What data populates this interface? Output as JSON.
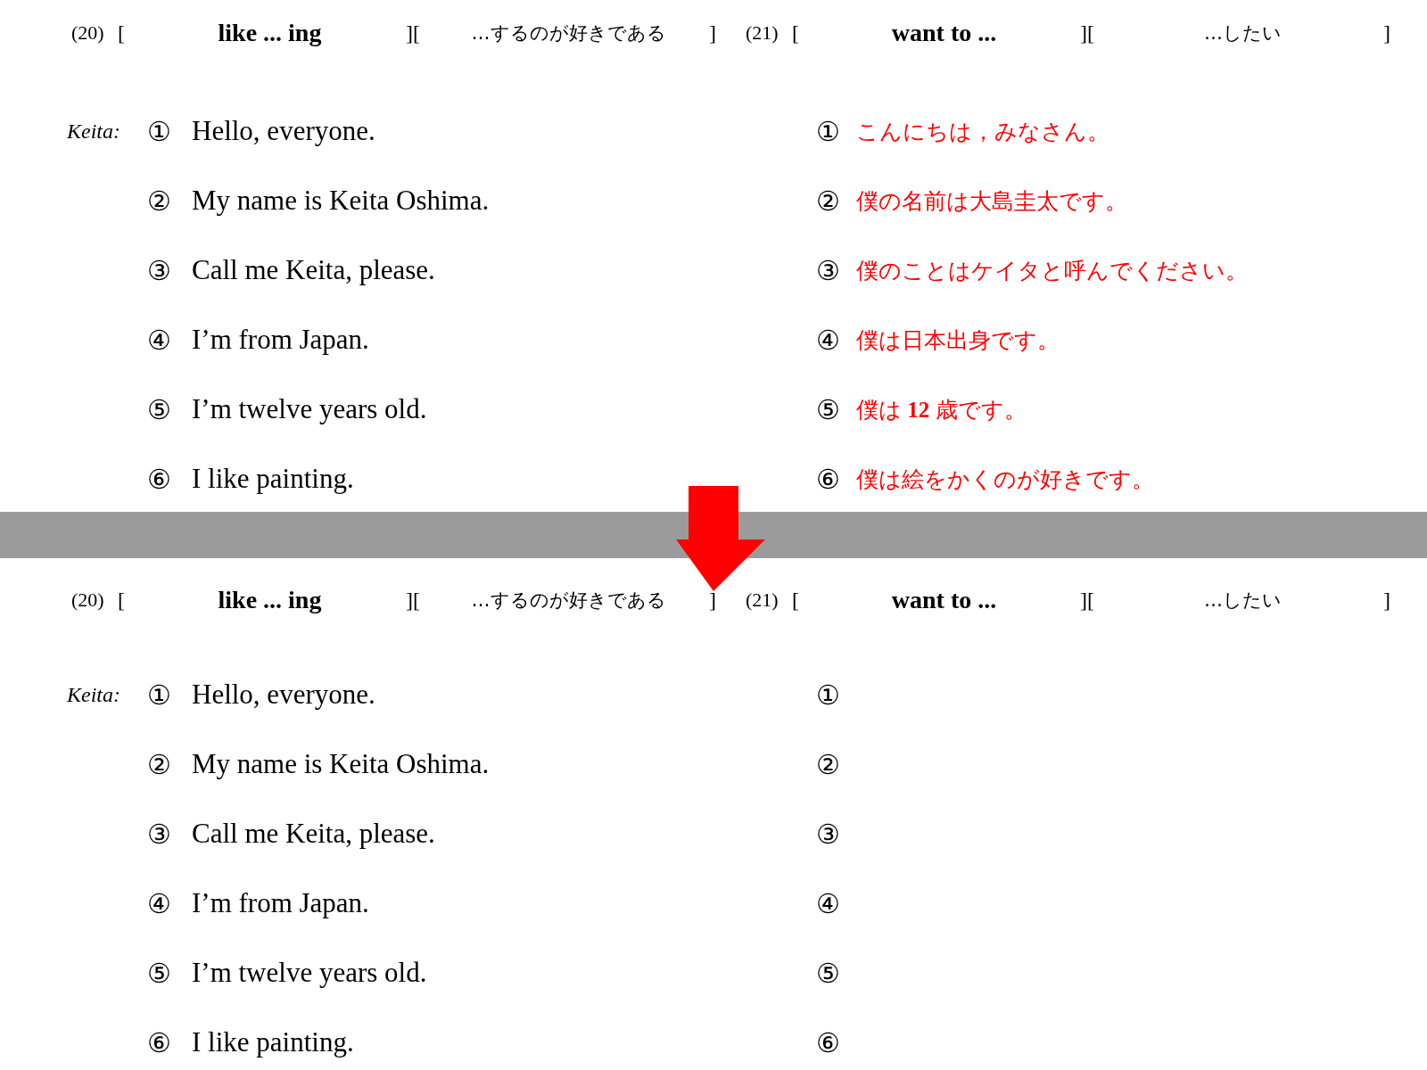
{
  "panels": [
    {
      "vocab": [
        {
          "number": "(20)",
          "open": "[",
          "english": "like ... ing",
          "middle": "][",
          "japanese": "…するのが好きである",
          "close": "]"
        },
        {
          "number": "(21)",
          "open": "[",
          "english": "want to ...",
          "middle": "][",
          "japanese": "…したい",
          "close": "]"
        }
      ],
      "speaker": "Keita:",
      "lines": [
        {
          "marker": "①",
          "english": "Hello, everyone.",
          "answer_marker": "①",
          "translation": "こんにちは，みなさん。"
        },
        {
          "marker": "②",
          "english": "My name is Keita Oshima.",
          "answer_marker": "②",
          "translation": "僕の名前は大島圭太です。"
        },
        {
          "marker": "③",
          "english": "Call me Keita, please.",
          "answer_marker": "③",
          "translation": "僕のことはケイタと呼んでください。"
        },
        {
          "marker": "④",
          "english": "I’m from Japan.",
          "answer_marker": "④",
          "translation": "僕は日本出身です。"
        },
        {
          "marker": "⑤",
          "english": "I’m twelve years old.",
          "answer_marker": "⑤",
          "translation": "僕は **12** 歳です。"
        },
        {
          "marker": "⑥",
          "english": "I like painting.",
          "answer_marker": "⑥",
          "translation": "僕は絵をかくのが好きです。"
        }
      ]
    },
    {
      "vocab": [
        {
          "number": "(20)",
          "open": "[",
          "english": "like ... ing",
          "middle": "][",
          "japanese": "…するのが好きである",
          "close": "]"
        },
        {
          "number": "(21)",
          "open": "[",
          "english": "want to ...",
          "middle": "][",
          "japanese": "…したい",
          "close": "]"
        }
      ],
      "speaker": "Keita:",
      "lines": [
        {
          "marker": "①",
          "english": "Hello, everyone.",
          "answer_marker": "①"
        },
        {
          "marker": "②",
          "english": "My name is Keita Oshima.",
          "answer_marker": "②"
        },
        {
          "marker": "③",
          "english": "Call me Keita, please.",
          "answer_marker": "③"
        },
        {
          "marker": "④",
          "english": "I’m from Japan.",
          "answer_marker": "④"
        },
        {
          "marker": "⑤",
          "english": "I’m twelve years old.",
          "answer_marker": "⑤"
        },
        {
          "marker": "⑥",
          "english": "I like painting.",
          "answer_marker": "⑥"
        }
      ]
    }
  ]
}
